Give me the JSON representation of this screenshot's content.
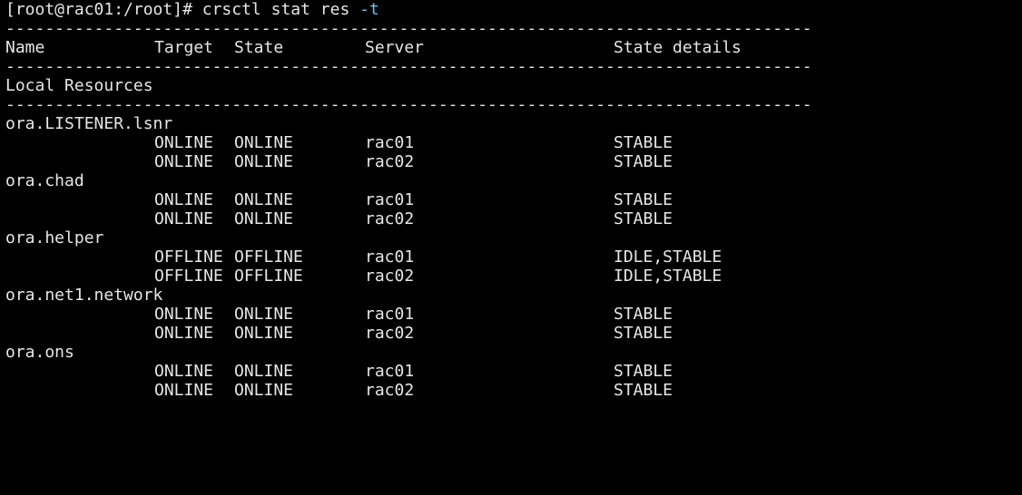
{
  "prompt": {
    "user_host": "[root@rac01:/root]#",
    "command": "crsctl stat res",
    "flag": "-t"
  },
  "separator": "----------------------------------------------------------------------------------",
  "headers": {
    "name": "Name",
    "target": "Target",
    "state": "State",
    "server": "Server",
    "details": "State details"
  },
  "section_title": "Local Resources",
  "resources": [
    {
      "name": "ora.LISTENER.lsnr",
      "rows": [
        {
          "target": "ONLINE",
          "state": "ONLINE",
          "server": "rac01",
          "details": "STABLE"
        },
        {
          "target": "ONLINE",
          "state": "ONLINE",
          "server": "rac02",
          "details": "STABLE"
        }
      ]
    },
    {
      "name": "ora.chad",
      "rows": [
        {
          "target": "ONLINE",
          "state": "ONLINE",
          "server": "rac01",
          "details": "STABLE"
        },
        {
          "target": "ONLINE",
          "state": "ONLINE",
          "server": "rac02",
          "details": "STABLE"
        }
      ]
    },
    {
      "name": "ora.helper",
      "rows": [
        {
          "target": "OFFLINE",
          "state": "OFFLINE",
          "server": "rac01",
          "details": "IDLE,STABLE"
        },
        {
          "target": "OFFLINE",
          "state": "OFFLINE",
          "server": "rac02",
          "details": "IDLE,STABLE"
        }
      ]
    },
    {
      "name": "ora.net1.network",
      "rows": [
        {
          "target": "ONLINE",
          "state": "ONLINE",
          "server": "rac01",
          "details": "STABLE"
        },
        {
          "target": "ONLINE",
          "state": "ONLINE",
          "server": "rac02",
          "details": "STABLE"
        }
      ]
    },
    {
      "name": "ora.ons",
      "rows": [
        {
          "target": "ONLINE",
          "state": "ONLINE",
          "server": "rac01",
          "details": "STABLE"
        },
        {
          "target": "ONLINE",
          "state": "ONLINE",
          "server": "rac02",
          "details": "STABLE"
        }
      ]
    }
  ],
  "colors": {
    "background": "#000000",
    "text": "#e6e6e6",
    "flag": "#5ec8ff"
  }
}
